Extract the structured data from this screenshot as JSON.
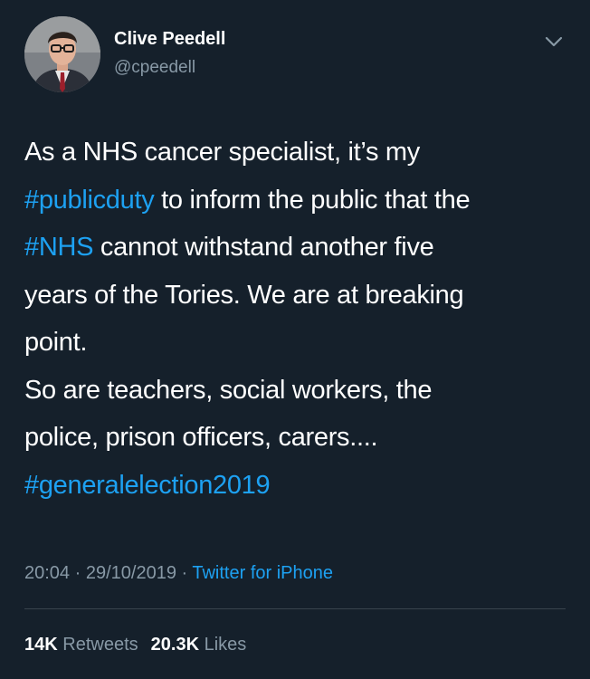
{
  "user": {
    "display_name": "Clive Peedell",
    "handle": "@cpeedell"
  },
  "tweet": {
    "line1": "As a NHS cancer specialist, it’s my",
    "line2_tag": "#publicduty",
    "line2_rest": " to inform the public that the",
    "line3_tag": "#NHS",
    "line3_rest": " cannot withstand another five",
    "line4": "years of the Tories. We are at breaking",
    "line5": "point.",
    "line6": "So are teachers, social workers, the",
    "line7": "police, prison officers, carers....",
    "line8_tag": "#generalelection2019"
  },
  "meta": {
    "time": "20:04",
    "separator": " · ",
    "date": "29/10/2019",
    "separator2": " · ",
    "source": "Twitter for iPhone"
  },
  "stats": {
    "retweets_count": "14K",
    "retweets_label": " Retweets",
    "likes_count": "20.3K",
    "likes_label": " Likes"
  },
  "colors": {
    "background": "#15202b",
    "link": "#1da1f2",
    "secondary": "#8899a6",
    "divider": "#38444d"
  },
  "icons": {
    "menu": "chevron-down-icon"
  }
}
